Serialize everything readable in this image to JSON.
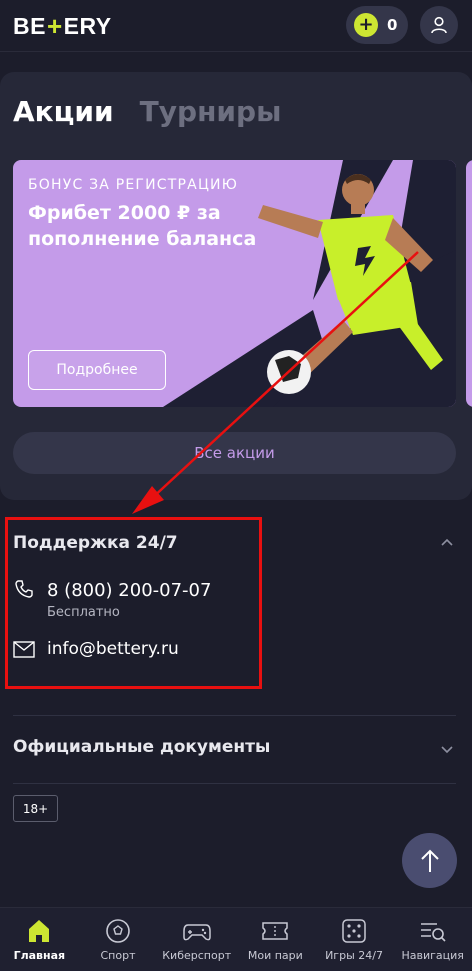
{
  "header": {
    "logo_text_left": "BE",
    "logo_plus": "+",
    "logo_text_right": "ERY",
    "balance_coin": "+",
    "balance_amount": "0",
    "avatar_icon": "user-icon"
  },
  "promo": {
    "tab_active": "Акции",
    "tab_inactive": "Турниры",
    "banner": {
      "kicker": "БОНУС ЗА РЕГИСТРАЦИЮ",
      "headline": "Фрибет 2000 ₽ за пополнение баланса",
      "button": "Подробнее"
    },
    "all_button": "Все акции"
  },
  "support": {
    "title": "Поддержка 24/7",
    "phone": "8 (800) 200-07-07",
    "phone_note": "Бесплатно",
    "email": "info@bettery.ru"
  },
  "documents": {
    "title": "Официальные документы"
  },
  "age_badge": "18+",
  "bottom_nav": [
    {
      "label": "Главная",
      "icon": "home-icon"
    },
    {
      "label": "Спорт",
      "icon": "soccer-ball-icon"
    },
    {
      "label": "Киберспорт",
      "icon": "gamepad-icon"
    },
    {
      "label": "Мои пари",
      "icon": "ticket-icon"
    },
    {
      "label": "Игры 24/7",
      "icon": "dice-icon"
    },
    {
      "label": "Навигация",
      "icon": "menu-search-icon"
    }
  ],
  "colors": {
    "background": "#1c1d2b",
    "card": "#262838",
    "accent_lime": "#cde632",
    "banner_purple": "#c49be9",
    "annotation_red": "#e81010"
  }
}
